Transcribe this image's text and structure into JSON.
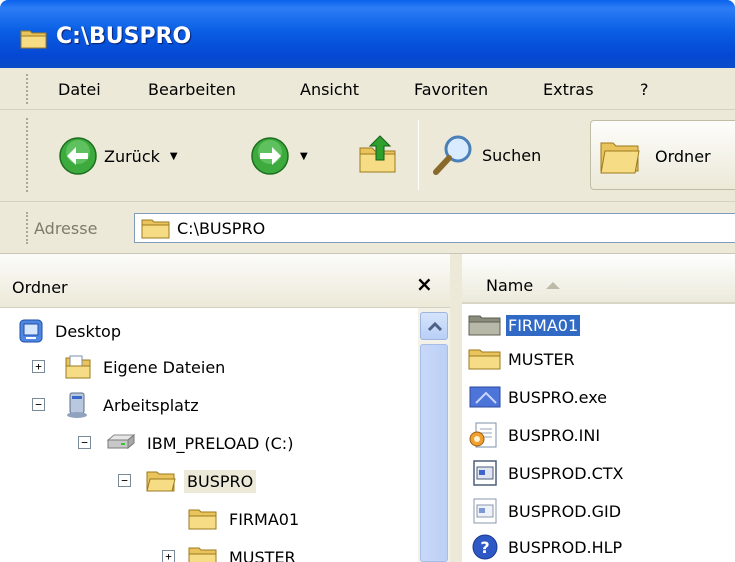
{
  "window": {
    "title": "C:\\BUSPRO"
  },
  "menu": [
    "Datei",
    "Bearbeiten",
    "Ansicht",
    "Favoriten",
    "Extras",
    "?"
  ],
  "toolbar": {
    "back_label": "Zurück",
    "search_label": "Suchen",
    "folders_label": "Ordner"
  },
  "address": {
    "label": "Adresse",
    "value": "C:\\BUSPRO"
  },
  "folder_pane": {
    "title": "Ordner",
    "close_glyph": "×",
    "tree": [
      {
        "label": "Desktop",
        "icon": "desktop-icon"
      },
      {
        "label": "Eigene Dateien",
        "icon": "my-documents-icon",
        "expander": "+"
      },
      {
        "label": "Arbeitsplatz",
        "icon": "my-computer-icon",
        "expander": "−"
      },
      {
        "label": "IBM_PRELOAD (C:)",
        "icon": "drive-icon",
        "expander": "−"
      },
      {
        "label": "BUSPRO",
        "icon": "folder-open-icon",
        "expander": "−",
        "selected": true
      },
      {
        "label": "FIRMA01",
        "icon": "folder-icon"
      },
      {
        "label": "MUSTER",
        "icon": "folder-icon",
        "expander": "+"
      }
    ]
  },
  "file_list": {
    "column_name": "Name",
    "files": [
      {
        "name": "FIRMA01",
        "icon": "folder-icon",
        "selected": true
      },
      {
        "name": "MUSTER",
        "icon": "folder-icon"
      },
      {
        "name": "BUSPRO.exe",
        "icon": "exe-icon"
      },
      {
        "name": "BUSPRO.INI",
        "icon": "ini-icon"
      },
      {
        "name": "BUSPROD.CTX",
        "icon": "ctx-icon"
      },
      {
        "name": "BUSPROD.GID",
        "icon": "gid-icon"
      },
      {
        "name": "BUSPROD.HLP",
        "icon": "help-icon"
      }
    ]
  },
  "colors": {
    "titlebar": "#0a5fe4",
    "selection": "#316ac5",
    "chrome": "#ece9d8"
  }
}
